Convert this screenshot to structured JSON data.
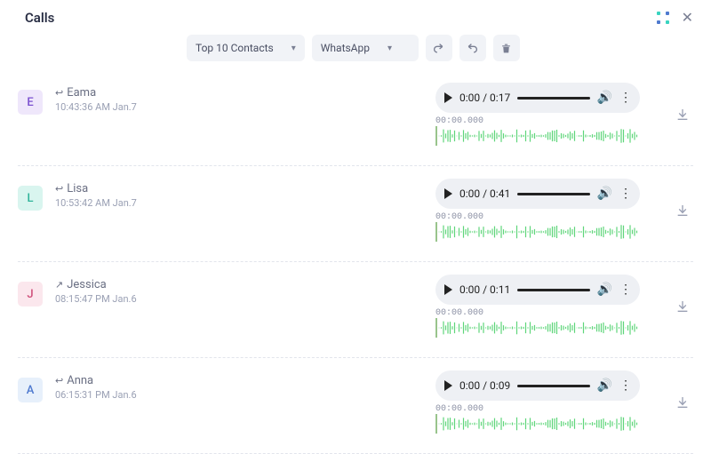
{
  "header": {
    "title": "Calls"
  },
  "toolbar": {
    "filter1_label": "Top 10 Contacts",
    "filter2_label": "WhatsApp"
  },
  "audio_defaults": {
    "wave_timestamp": "00:00.000"
  },
  "calls": [
    {
      "initial": "E",
      "avatar_bg": "#efe7fb",
      "avatar_fg": "#7a4fcf",
      "direction": "in",
      "name": "Eama",
      "timestamp": "10:43:36 AM Jan.7",
      "current": "0:00",
      "duration": "0:17",
      "wave_ts": "00:00.000"
    },
    {
      "initial": "L",
      "avatar_bg": "#d9f5ef",
      "avatar_fg": "#2fb39a",
      "direction": "in",
      "name": "Lisa",
      "timestamp": "10:53:42 AM Jan.7",
      "current": "0:00",
      "duration": "0:41",
      "wave_ts": "00:00.000"
    },
    {
      "initial": "J",
      "avatar_bg": "#fbe7ed",
      "avatar_fg": "#cf4f7a",
      "direction": "out",
      "name": "Jessica",
      "timestamp": "08:15:47 PM Jan.6",
      "current": "0:00",
      "duration": "0:11",
      "wave_ts": "00:00.000"
    },
    {
      "initial": "A",
      "avatar_bg": "#e7f0fb",
      "avatar_fg": "#4f7acf",
      "direction": "in",
      "name": "Anna",
      "timestamp": "06:15:31 PM Jan.6",
      "current": "0:00",
      "duration": "0:09",
      "wave_ts": "00:00.000"
    }
  ]
}
